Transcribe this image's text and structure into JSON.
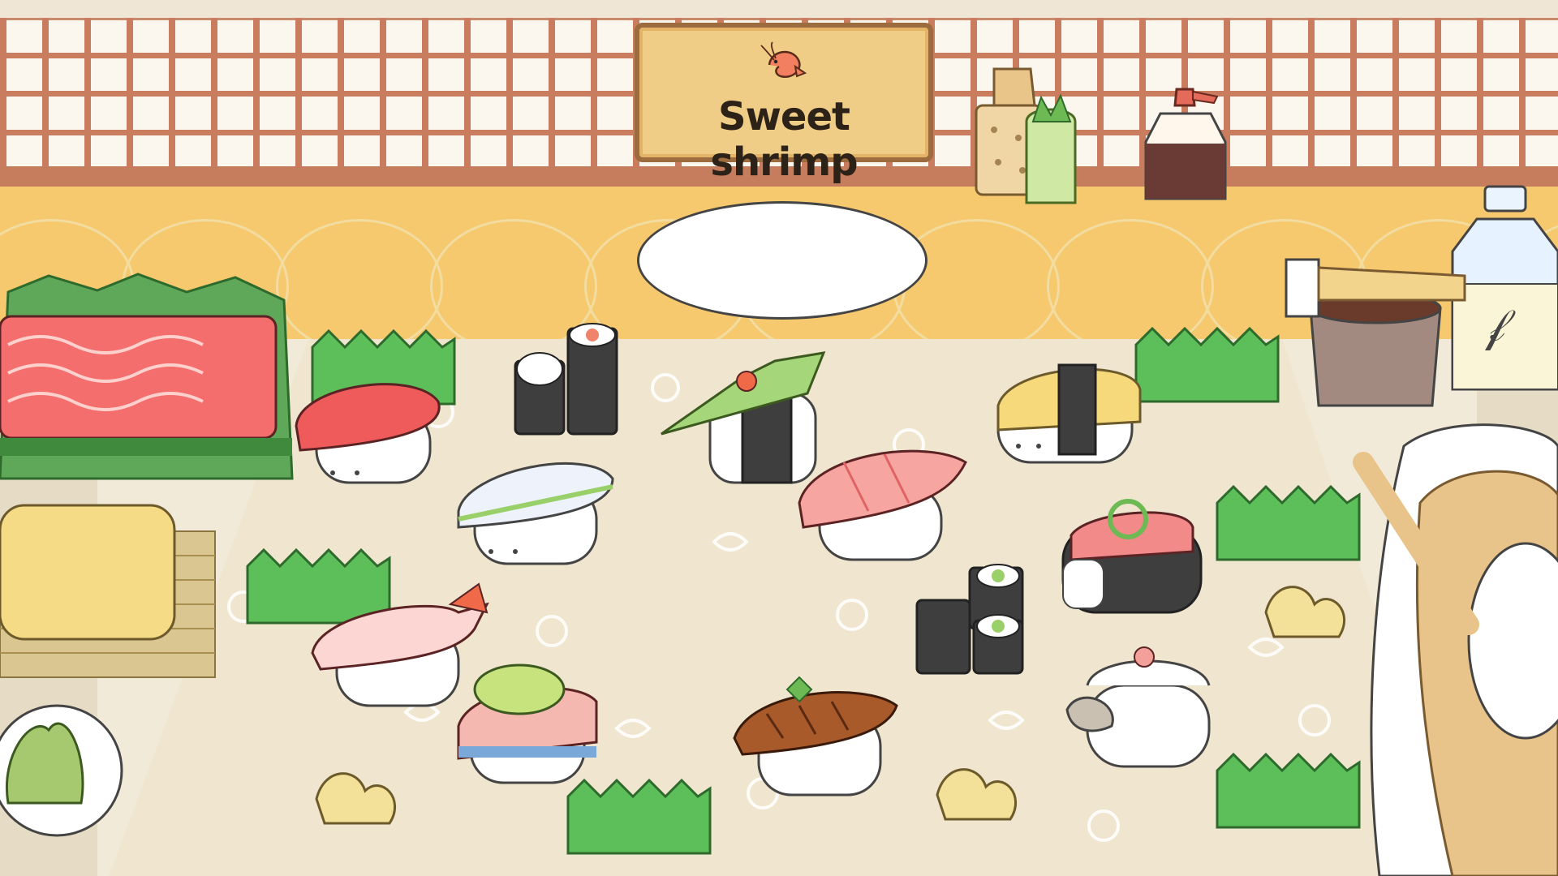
{
  "sign": {
    "title": "Sweet shrimp",
    "icon": "shrimp-icon"
  },
  "colors": {
    "wall": "#fbf7ee",
    "lattice": "#c97c5e",
    "counter": "#f6c96f",
    "table": "#f2ead8",
    "leaf_green": "#4caf50",
    "tuna_red": "#f25c5c",
    "sign_bg": "#f0cd86"
  },
  "sushi_pieces": [
    "tuna-nigiri",
    "flounder-nigiri",
    "negi-gunkan",
    "cucumber-roll",
    "tamago-nigiri",
    "toro-nigiri",
    "sweet-shrimp-nigiri",
    "lime-fish-nigiri",
    "eel-nigiri",
    "negitoro-gunkan",
    "kappa-maki",
    "scallop-nigiri"
  ],
  "props": [
    "tuna-block",
    "tamago-block",
    "wasabi-dish",
    "grater",
    "wasabi-root",
    "soy-sauce-bottle",
    "sauce-brush",
    "sauce-pot",
    "water-bottle",
    "rice-tub",
    "serving-plate",
    "gari-ginger",
    "baran-leaf"
  ]
}
